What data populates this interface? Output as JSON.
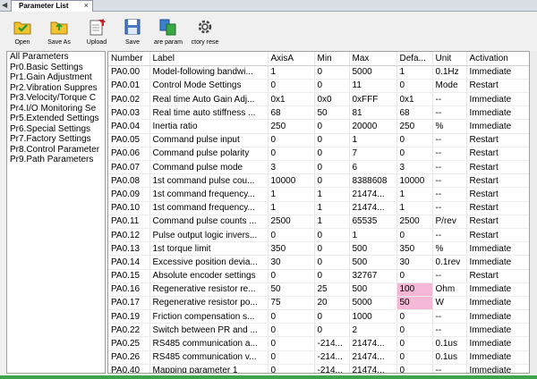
{
  "tab": {
    "title": "Parameter List",
    "close_glyph": "×"
  },
  "toolbar": [
    {
      "name": "open-button",
      "icon": "open-folder-icon",
      "label": "Open"
    },
    {
      "name": "save-as-button",
      "icon": "save-as-icon",
      "label": "Save As"
    },
    {
      "name": "upload-button",
      "icon": "upload-icon",
      "label": "Upload"
    },
    {
      "name": "save-button",
      "icon": "floppy-disk-icon",
      "label": "Save"
    },
    {
      "name": "compare-param-button",
      "icon": "compare-icon",
      "label": "are param"
    },
    {
      "name": "factory-reset-button",
      "icon": "gear-icon",
      "label": "ctory rese"
    }
  ],
  "tree": {
    "items": [
      "All Parameters",
      "Pr0.Basic Settings",
      "Pr1.Gain Adjustment",
      "Pr2.Vibration Suppres",
      "Pr3.Velocity/Torque C",
      "Pr4.I/O Monitoring Se",
      "Pr5.Extended Settings",
      "Pr6.Special Settings",
      "Pr7.Factory Settings",
      "Pr8.Control Parameter",
      "Pr9.Path Parameters"
    ]
  },
  "table": {
    "columns": [
      "Number",
      "Label",
      "AxisA",
      "Min",
      "Max",
      "Defa...",
      "Unit",
      "Activation"
    ],
    "rows": [
      [
        "PA0.00",
        "Model-following bandwi...",
        "1",
        "0",
        "5000",
        "1",
        "0.1Hz",
        "Immediate"
      ],
      [
        "PA0.01",
        "Control Mode Settings",
        "0",
        "0",
        "11",
        "0",
        "Mode",
        "Restart"
      ],
      [
        "PA0.02",
        "Real time Auto Gain Adj...",
        "0x1",
        "0x0",
        "0xFFF",
        "0x1",
        "--",
        "Immediate"
      ],
      [
        "PA0.03",
        "Real time auto stiffness ...",
        "68",
        "50",
        "81",
        "68",
        "--",
        "Immediate"
      ],
      [
        "PA0.04",
        "Inertia ratio",
        "250",
        "0",
        "20000",
        "250",
        "%",
        "Immediate"
      ],
      [
        "PA0.05",
        "Command pulse input",
        "0",
        "0",
        "1",
        "0",
        "--",
        "Restart"
      ],
      [
        "PA0.06",
        "Command pulse polarity",
        "0",
        "0",
        "7",
        "0",
        "--",
        "Restart"
      ],
      [
        "PA0.07",
        "Command pulse mode",
        "3",
        "0",
        "6",
        "3",
        "--",
        "Restart"
      ],
      [
        "PA0.08",
        "1st command pulse cou...",
        "10000",
        "0",
        "8388608",
        "10000",
        "--",
        "Restart"
      ],
      [
        "PA0.09",
        "1st command frequency...",
        "1",
        "1",
        "21474...",
        "1",
        "--",
        "Restart"
      ],
      [
        "PA0.10",
        "1st command frequency...",
        "1",
        "1",
        "21474...",
        "1",
        "--",
        "Restart"
      ],
      [
        "PA0.11",
        "Command pulse counts ...",
        "2500",
        "1",
        "65535",
        "2500",
        "P/rev",
        "Restart"
      ],
      [
        "PA0.12",
        "Pulse output logic invers...",
        "0",
        "0",
        "1",
        "0",
        "--",
        "Restart"
      ],
      [
        "PA0.13",
        "1st torque limit",
        "350",
        "0",
        "500",
        "350",
        "%",
        "Immediate"
      ],
      [
        "PA0.14",
        "Excessive position devia...",
        "30",
        "0",
        "500",
        "30",
        "0.1rev",
        "Immediate"
      ],
      [
        "PA0.15",
        "Absolute encoder settings",
        "0",
        "0",
        "32767",
        "0",
        "--",
        "Restart"
      ],
      [
        "PA0.16",
        "Regenerative resistor re...",
        "50",
        "25",
        "500",
        "100",
        "Ohm",
        "Immediate"
      ],
      [
        "PA0.17",
        "Regenerative resistor po...",
        "75",
        "20",
        "5000",
        "50",
        "W",
        "Immediate"
      ],
      [
        "PA0.19",
        "Friction compensation s...",
        "0",
        "0",
        "1000",
        "0",
        "--",
        "Immediate"
      ],
      [
        "PA0.22",
        "Switch between PR and ...",
        "0",
        "0",
        "2",
        "0",
        "--",
        "Immediate"
      ],
      [
        "PA0.25",
        "RS485 communication a...",
        "0",
        "-214...",
        "21474...",
        "0",
        "0.1us",
        "Immediate"
      ],
      [
        "PA0.26",
        "RS485 communication v...",
        "0",
        "-214...",
        "21474...",
        "0",
        "0.1us",
        "Immediate"
      ],
      [
        "PA0.40",
        "Mapping parameter 1",
        "0",
        "-214...",
        "21474...",
        "0",
        "--",
        "Immediate"
      ]
    ],
    "highlighted_cells": [
      [
        16,
        5
      ],
      [
        17,
        5
      ]
    ],
    "highlight_color": "#f5b7d6"
  },
  "colors": {
    "status_bar": "#3fa34d"
  }
}
